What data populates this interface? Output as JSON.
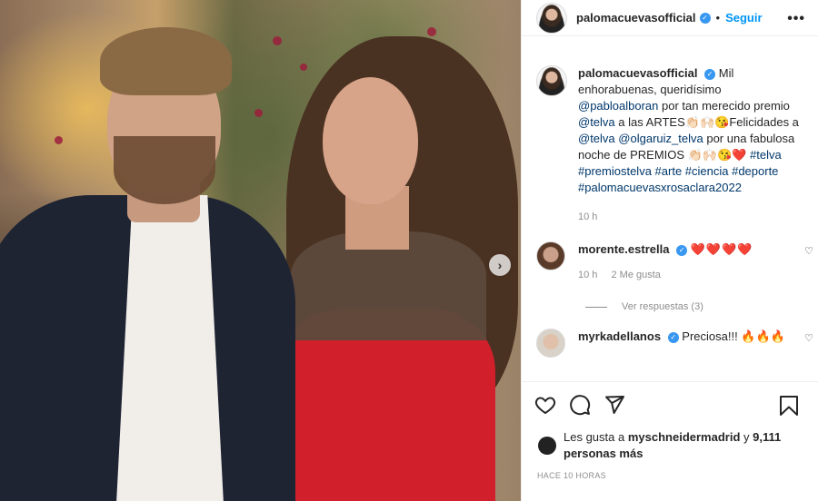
{
  "post": {
    "username": "palomacuevasofficial",
    "follow_label": "Seguir",
    "more_label": "•••",
    "next_label": "›"
  },
  "caption": {
    "username": "palomacuevasofficial",
    "lead": "Mil enhorabuenas, queridísimo",
    "mention1": "@pabloalboran",
    "text1": "por tan merecido premio",
    "mention2": "@telva",
    "text2": "a las ARTES👏🏻🙌🏻😘Felicidades a",
    "mention3": "@telva",
    "mention4": "@olgaruiz_telva",
    "text3": "por una fabulosa noche de PREMIOS 👏🏻🙌🏻😘❤️",
    "hashtags": "#telva #premiostelva #arte #ciencia #deporte #palomacuevasxrosaclara2022",
    "time": "10 h"
  },
  "comments": [
    {
      "username": "morente.estrella",
      "text": "❤️❤️❤️❤️",
      "time": "10 h",
      "likes": "2 Me gusta",
      "replies": "Ver respuestas (3)"
    },
    {
      "username": "myrkadellanos",
      "text": "Preciosa!!!",
      "emoji": "🔥🔥🔥"
    }
  ],
  "likes": {
    "prefix": "Les gusta a",
    "user": "myschneidermadrid",
    "suffix": "y",
    "count": "9,111 personas más"
  },
  "timestamp": "HACE 10 HORAS",
  "colors": {
    "accent": "#0095f6",
    "verified": "#3897f0"
  }
}
